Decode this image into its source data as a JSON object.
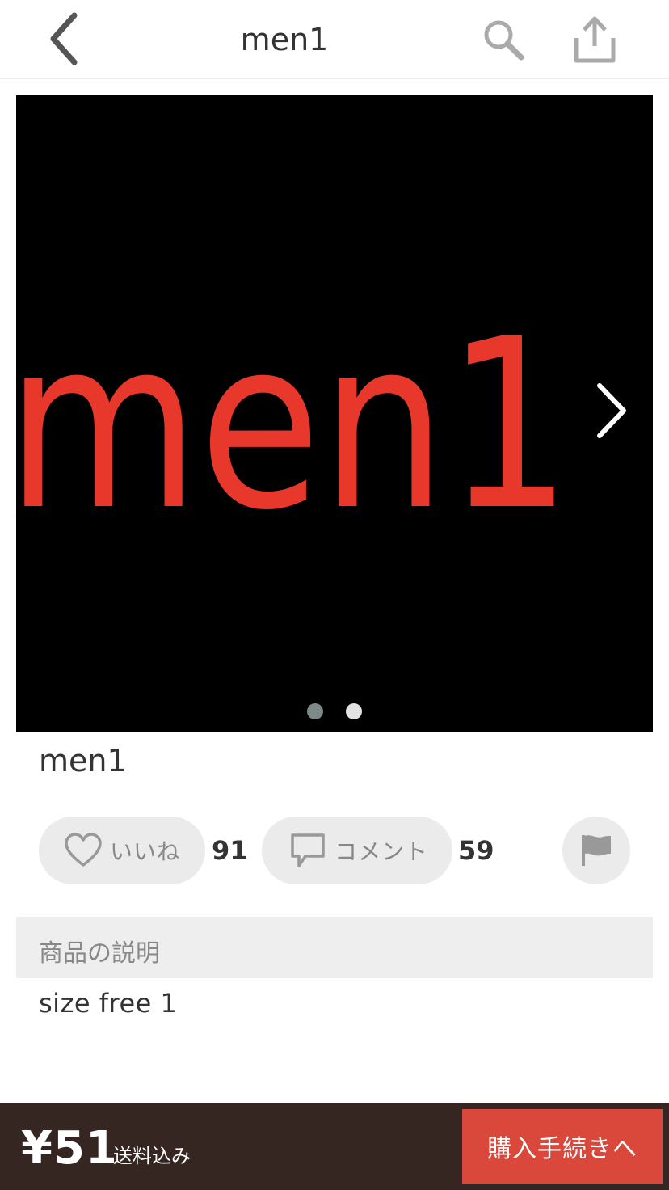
{
  "header": {
    "title": "men1",
    "icons": {
      "back": "chevron-left-icon",
      "search": "search-icon",
      "share": "share-icon"
    }
  },
  "carousel": {
    "image_text": "men1",
    "image_text_color": "#e8382b",
    "background_color": "#000000",
    "page_count": 2,
    "active_page": 1
  },
  "item": {
    "name": "men1"
  },
  "actions": {
    "like_label": "いいね",
    "like_count": "91",
    "comment_label": "コメント",
    "comment_count": "59"
  },
  "description": {
    "header": "商品の説明",
    "text": "size free 1"
  },
  "purchase": {
    "price": "¥51",
    "shipping_note": "送料込み",
    "button_label": "購入手続きへ",
    "button_color": "#d9483b",
    "bar_color": "#352622"
  }
}
